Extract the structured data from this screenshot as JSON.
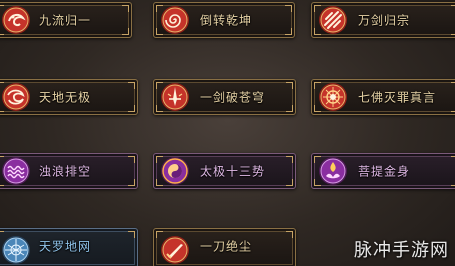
{
  "skills": [
    {
      "name": "九流归一",
      "icon": "swirl-tiger-icon"
    },
    {
      "name": "倒转乾坤",
      "icon": "spiral-cloud-icon"
    },
    {
      "name": "万剑归宗",
      "icon": "sword-slash-icon"
    },
    {
      "name": "天地无极",
      "icon": "yin-yang-swirl-icon"
    },
    {
      "name": "一剑破苍穹",
      "icon": "upright-sword-icon"
    },
    {
      "name": "七佛灭罪真言",
      "icon": "buddha-wheel-icon"
    },
    {
      "name": "浊浪排空",
      "icon": "wave-icon"
    },
    {
      "name": "太极十三势",
      "icon": "taiji-icon"
    },
    {
      "name": "菩提金身",
      "icon": "lotus-flame-icon"
    },
    {
      "name": "天罗地网",
      "icon": "net-icon"
    },
    {
      "name": "一刀绝尘",
      "icon": "blade-icon"
    }
  ],
  "watermark": "脉冲手游网",
  "colors": {
    "gold_text": "#e7d3a6",
    "violet_text": "#e0b9e6",
    "cyan_text": "#8fc3ea",
    "frame_gold": "#8a7044",
    "icon_red": "#c23a2a"
  }
}
